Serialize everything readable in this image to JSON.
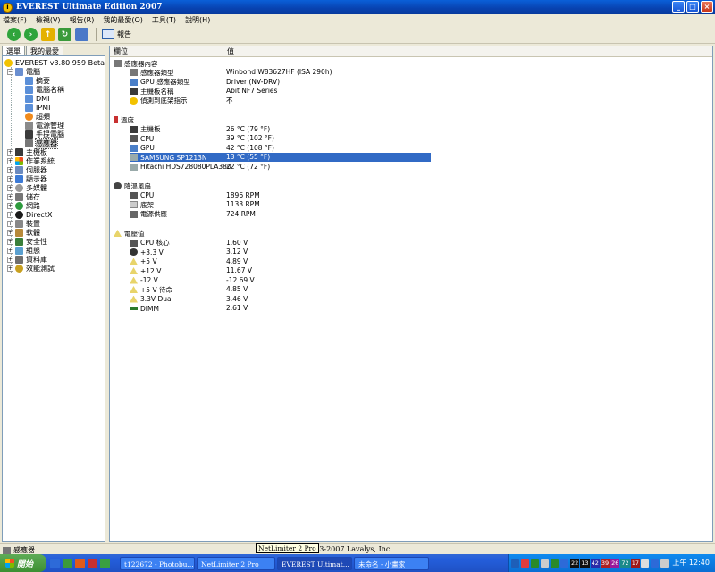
{
  "window": {
    "title": "EVEREST Ultimate Edition 2007",
    "min_label": "_",
    "max_label": "□",
    "close_label": "×"
  },
  "menu": [
    "檔案(F)",
    "檢視(V)",
    "報告(R)",
    "我的最愛(O)",
    "工具(T)",
    "說明(H)"
  ],
  "toolbar": {
    "report_label": "報告"
  },
  "left_tabs": [
    "選單",
    "我的最愛"
  ],
  "tree": {
    "root": "EVEREST v3.80.959 Beta",
    "computer": "電腦",
    "computer_children": [
      "摘要",
      "電腦名稱",
      "DMI",
      "IPMI",
      "超頻",
      "電源管理",
      "手提電腦",
      "感應器"
    ],
    "top_items": [
      "主機板",
      "作業系統",
      "伺服器",
      "顯示器",
      "多媒體",
      "儲存",
      "網路",
      "DirectX",
      "裝置",
      "軟體",
      "安全性",
      "組態",
      "資料庫",
      "效能測試"
    ]
  },
  "columns": {
    "field": "欄位",
    "value": "值"
  },
  "sections": {
    "sensor_props": {
      "title": "感應器內容",
      "rows": [
        {
          "field": "感應器類型",
          "value": "Winbond W83627HF  (ISA 290h)"
        },
        {
          "field": "GPU 感應器類型",
          "value": "Driver  (NV-DRV)"
        },
        {
          "field": "主機板名稱",
          "value": "Abit NF7 Series"
        },
        {
          "field": "偵測到底架指示",
          "value": "不"
        }
      ]
    },
    "temperatures": {
      "title": "溫度",
      "rows": [
        {
          "field": "主機板",
          "value": "26 °C  (79 °F)"
        },
        {
          "field": "CPU",
          "value": "39 °C  (102 °F)"
        },
        {
          "field": "GPU",
          "value": "42 °C  (108 °F)"
        },
        {
          "field": "SAMSUNG SP1213N",
          "value": "13 °C  (55 °F)"
        },
        {
          "field": "Hitachi HDS728080PLA380",
          "value": "22 °C  (72 °F)"
        }
      ]
    },
    "fans": {
      "title": "降溫風扇",
      "rows": [
        {
          "field": "CPU",
          "value": "1896 RPM"
        },
        {
          "field": "底架",
          "value": "1133 RPM"
        },
        {
          "field": "電源供應",
          "value": "724 RPM"
        }
      ]
    },
    "voltages": {
      "title": "電壓值",
      "rows": [
        {
          "field": "CPU 核心",
          "value": "1.60 V"
        },
        {
          "field": "+3.3 V",
          "value": "3.12 V"
        },
        {
          "field": "+5 V",
          "value": "4.89 V"
        },
        {
          "field": "+12 V",
          "value": "11.67 V"
        },
        {
          "field": "-12 V",
          "value": "-12.69 V"
        },
        {
          "field": "+5 V 待命",
          "value": "4.85 V"
        },
        {
          "field": "3.3V Dual",
          "value": "3.46 V"
        },
        {
          "field": "DIMM",
          "value": "2.61 V"
        }
      ]
    }
  },
  "status": {
    "left": "感應器",
    "tooltip": "NetLimiter 2 Pro",
    "copyright": "2003-2007 Lavalys, Inc."
  },
  "taskbar": {
    "start": "開始",
    "tasks": [
      "t122672 - Photobu...",
      "NetLimiter 2 Pro",
      "EVEREST Ultimat...",
      "未命名 - 小畫家"
    ],
    "tray_numbers": [
      "22",
      "13",
      "42",
      "39",
      "26",
      "72",
      "17"
    ],
    "clock": "上午 12:40"
  },
  "colors": {
    "selection": "#316ac5",
    "titlebar": "#0842b0",
    "taskbar": "#245edb"
  }
}
